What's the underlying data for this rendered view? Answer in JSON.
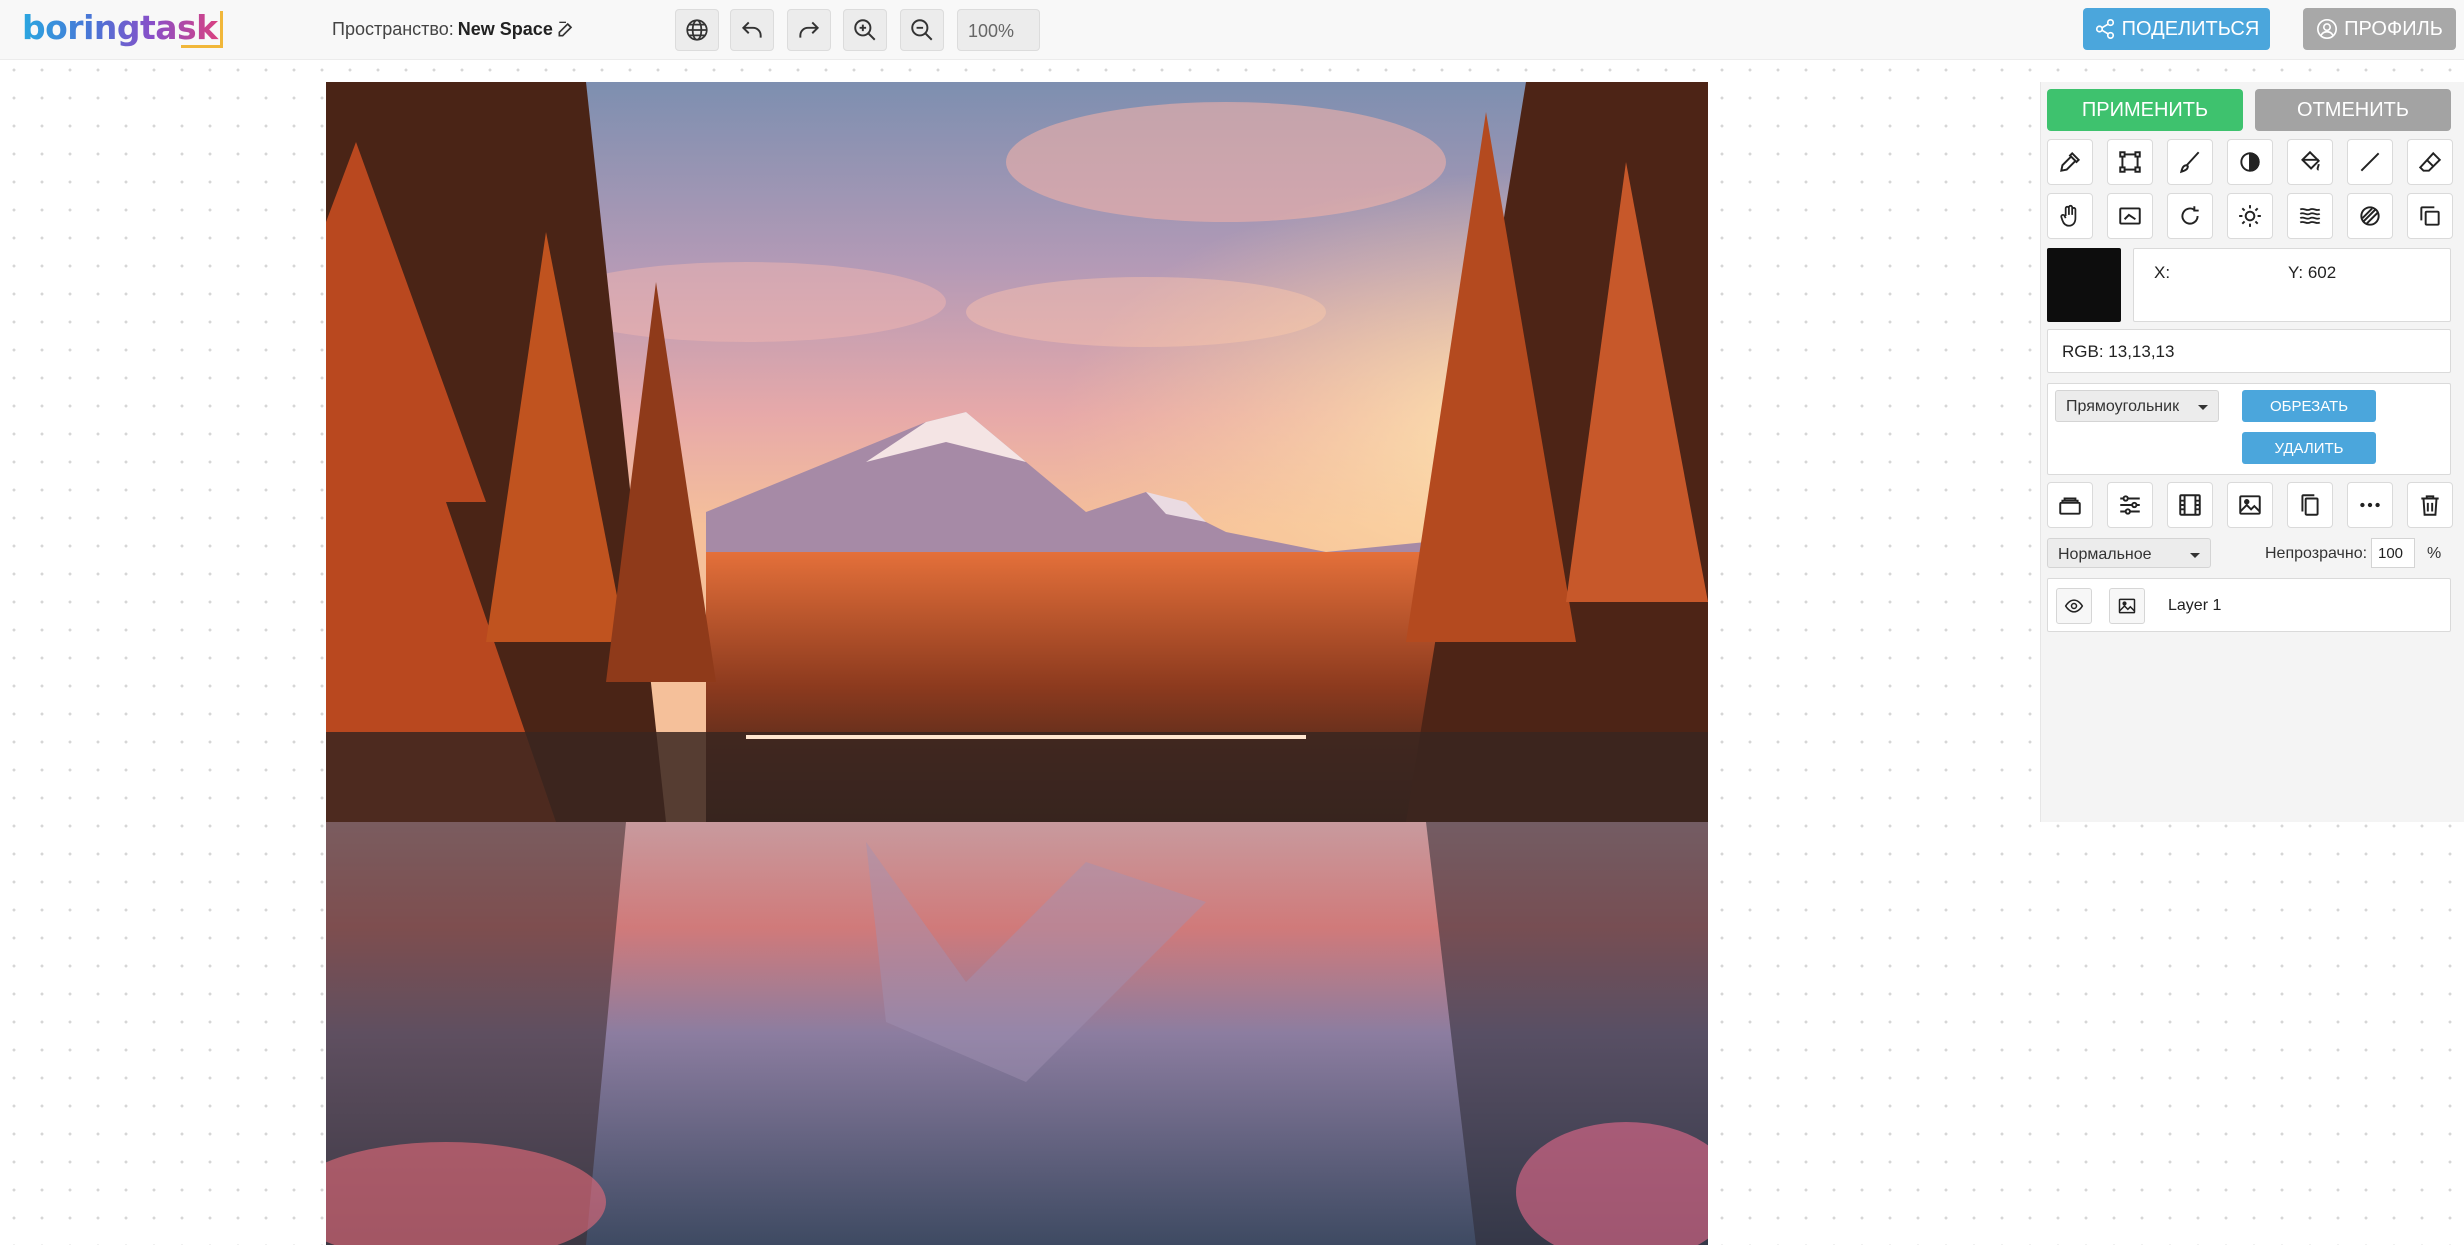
{
  "header": {
    "logo": "boringtask",
    "space_label": "Пространство:",
    "space_name": "New Space",
    "zoom": "100%",
    "share_label": "ПОДЕЛИТЬСЯ",
    "profile_label": "ПРОФИЛЬ",
    "toolbar_icons": [
      "globe-icon",
      "undo-icon",
      "redo-icon",
      "zoom-in-icon",
      "zoom-out-icon"
    ]
  },
  "panel": {
    "apply_label": "ПРИМЕНИТЬ",
    "cancel_label": "ОТМЕНИТЬ",
    "tools_row1": [
      "eyedropper-icon",
      "crop-icon",
      "brush-icon",
      "contrast-icon",
      "paint-bucket-icon",
      "line-icon",
      "eraser-icon"
    ],
    "tools_row2": [
      "hand-icon",
      "frame-icon",
      "rotate-icon",
      "brightness-icon",
      "blur-icon",
      "gradient-icon",
      "duplicate-icon"
    ],
    "color_hex": "#0d0d0d",
    "x_label": "X:",
    "y_label": "Y: 602",
    "rgb_label": "RGB: 13,13,13",
    "shape_select": "Прямоугольник",
    "crop_label": "ОБРЕЗАТЬ",
    "delete_label": "УДАЛИТЬ",
    "layer_tools": [
      "layers-icon",
      "sliders-icon",
      "film-icon",
      "image-icon",
      "copy-icon",
      "more-icon",
      "trash-icon"
    ],
    "blend_select": "Нормальное",
    "opacity_label": "Непрозрачно:",
    "opacity_value": "100",
    "opacity_unit": "%",
    "layer_name": "Layer 1"
  },
  "colors": {
    "share": "#4ba6dc",
    "profile": "#a8a8a8",
    "apply": "#3ec26e",
    "cancel": "#a3a3a3"
  }
}
